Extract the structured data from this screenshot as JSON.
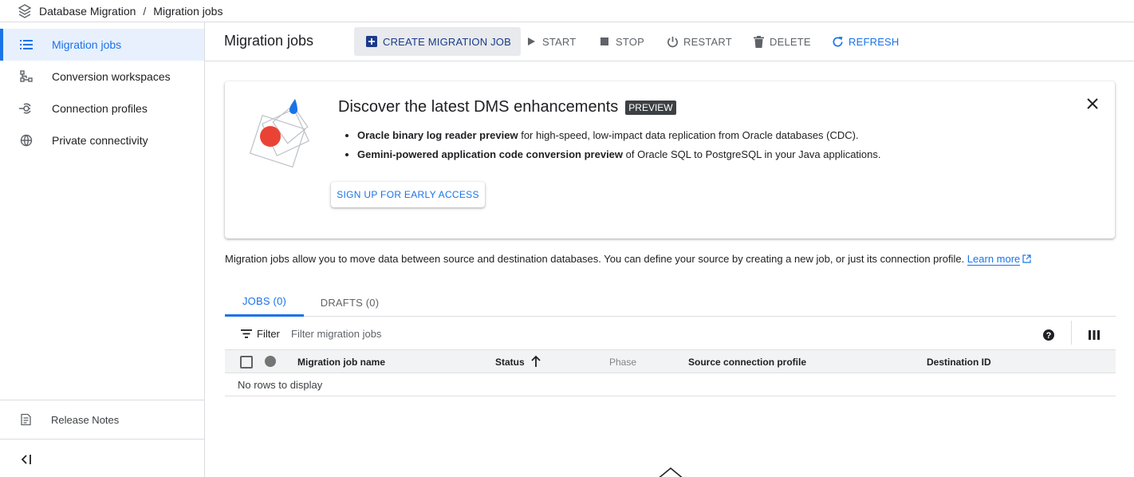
{
  "breadcrumb": {
    "product": "Database Migration",
    "separator": "/",
    "current": "Migration jobs"
  },
  "sidebar": {
    "items": [
      {
        "label": "Migration jobs",
        "icon": "list-icon",
        "active": true
      },
      {
        "label": "Conversion workspaces",
        "icon": "schema-icon"
      },
      {
        "label": "Connection profiles",
        "icon": "connection-icon"
      },
      {
        "label": "Private connectivity",
        "icon": "globe-network-icon"
      }
    ],
    "footer": {
      "release_notes": "Release Notes",
      "collapse_icon": "collapse-left-icon"
    }
  },
  "toolbar": {
    "title": "Migration jobs",
    "create": "CREATE MIGRATION JOB",
    "start": "START",
    "stop": "STOP",
    "restart": "RESTART",
    "delete": "DELETE",
    "refresh": "REFRESH"
  },
  "banner": {
    "title": "Discover the latest DMS enhancements",
    "badge": "PREVIEW",
    "bullets": [
      {
        "bold": "Oracle binary log reader preview",
        "rest": " for high-speed, low-impact data replication from Oracle databases (CDC)."
      },
      {
        "bold": "Gemini-powered application code conversion preview",
        "rest": " of Oracle SQL to PostgreSQL in your Java applications."
      }
    ],
    "cta": "SIGN UP FOR EARLY ACCESS"
  },
  "info": {
    "text": "Migration jobs allow you to move data between source and destination databases. You can define your source by creating a new job, or just its connection profile. ",
    "link": "Learn more"
  },
  "tabs": [
    {
      "label": "JOBS (0)",
      "active": true
    },
    {
      "label": "DRAFTS (0)",
      "active": false
    }
  ],
  "filter": {
    "label": "Filter",
    "placeholder": "Filter migration jobs"
  },
  "table": {
    "columns": [
      "Migration job name",
      "Status",
      "Phase",
      "Source connection profile",
      "Destination ID"
    ],
    "empty": "No rows to display"
  },
  "colors": {
    "accent": "#1a73e8",
    "active_bg": "#e8f0fe",
    "badge_bg": "#3c4043",
    "art_red": "#ea4335",
    "art_blue": "#1a73e8"
  }
}
